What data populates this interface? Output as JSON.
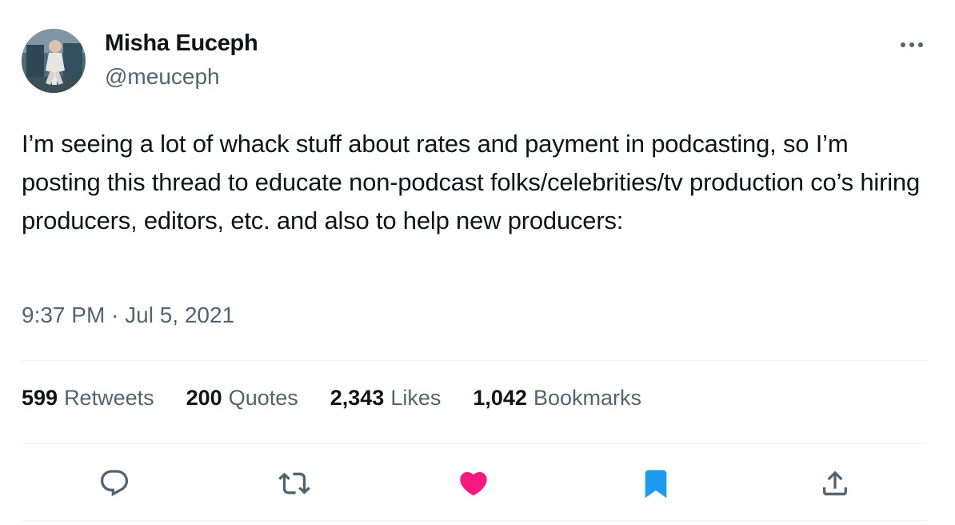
{
  "author": {
    "display_name": "Misha Euceph",
    "handle": "@meuceph"
  },
  "tweet": {
    "text": "I’m seeing a lot of whack stuff about rates and payment in podcasting, so I’m posting this thread to educate non-podcast folks/celebrities/tv production co’s hiring producers, editors, etc. and also to help new producers:",
    "timestamp": "9:37 PM · Jul 5, 2021"
  },
  "stats": {
    "retweets": {
      "count": "599",
      "label": "Retweets"
    },
    "quotes": {
      "count": "200",
      "label": "Quotes"
    },
    "likes": {
      "count": "2,343",
      "label": "Likes"
    },
    "bookmarks": {
      "count": "1,042",
      "label": "Bookmarks"
    }
  },
  "actions": [
    {
      "name": "reply-icon",
      "active": false
    },
    {
      "name": "retweet-icon",
      "active": false
    },
    {
      "name": "heart-icon",
      "active": true,
      "color": "#f91880"
    },
    {
      "name": "bookmark-icon",
      "active": true,
      "color": "#1d9bf0"
    },
    {
      "name": "share-icon",
      "active": false
    }
  ],
  "colors": {
    "text_primary": "#0f1419",
    "text_secondary": "#536471",
    "like": "#f91880",
    "bookmark": "#1d9bf0",
    "divider": "#eff3f4"
  }
}
